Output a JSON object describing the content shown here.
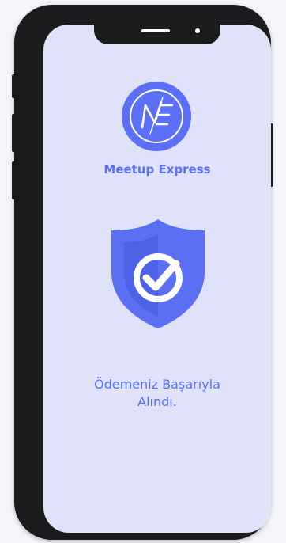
{
  "app": {
    "name": "Meetup Express",
    "logo_monogram": "ME"
  },
  "status": {
    "icon": "shield-check-icon",
    "message_line1": "Ödemeniz Başarıyla",
    "message_line2": "Alındı."
  },
  "colors": {
    "accent": "#5b6ff3",
    "screen_bg": "#dfe2f9",
    "frame": "#1b1b1d"
  }
}
